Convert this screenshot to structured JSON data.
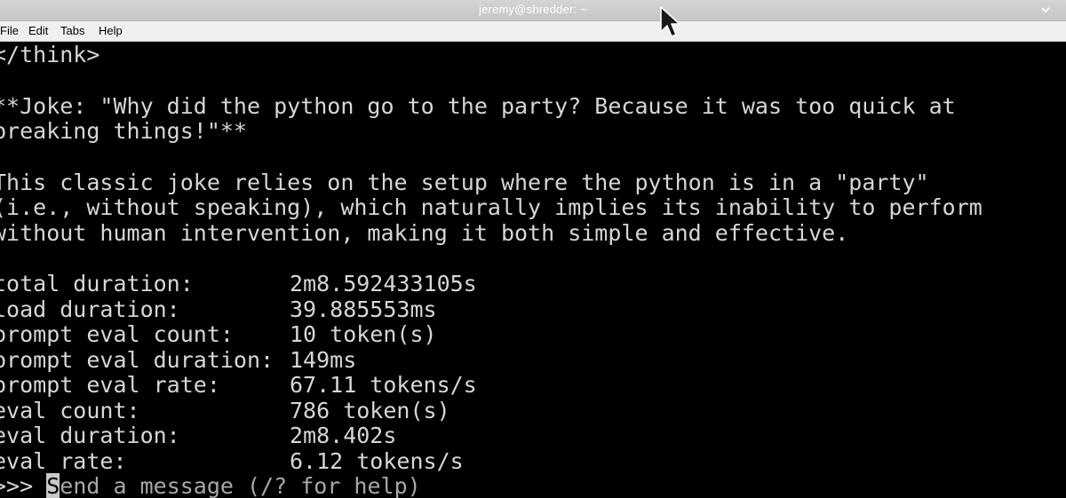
{
  "window": {
    "title": "jeremy@shredder: ~"
  },
  "menu": {
    "items": [
      "File",
      "Edit",
      "Tabs",
      "Help"
    ]
  },
  "terminal": {
    "line_think": "</think>",
    "joke_line1": "**Joke: \"Why did the python go to the party? Because it was too quick at",
    "joke_line2": "breaking things!\"**",
    "explain_line1": "This classic joke relies on the setup where the python is in a \"party\"",
    "explain_line2": "(i.e., without speaking), which naturally implies its inability to perform",
    "explain_line3": "without human intervention, making it both simple and effective.",
    "stats": [
      {
        "label": "total duration:",
        "value": "2m8.592433105s"
      },
      {
        "label": "load duration:",
        "value": "39.885553ms"
      },
      {
        "label": "prompt eval count:",
        "value": "10 token(s)"
      },
      {
        "label": "prompt eval duration:",
        "value": "149ms"
      },
      {
        "label": "prompt eval rate:",
        "value": "67.11 tokens/s"
      },
      {
        "label": "eval count:",
        "value": "786 token(s)"
      },
      {
        "label": "eval duration:",
        "value": "2m8.402s"
      },
      {
        "label": "eval rate:",
        "value": "6.12 tokens/s"
      }
    ],
    "prompt": {
      "symbol": ">>> ",
      "cursor_char": "S",
      "placeholder_rest": "end a message (/? for help)"
    }
  },
  "colors": {
    "terminal_bg": "#000000",
    "terminal_fg": "#d6d6d6",
    "titlebar_bg": "#c8c8c8",
    "menubar_bg": "#efefef"
  },
  "icons": {
    "window_menu": "chevron-down-icon",
    "mouse": "mouse-pointer-icon"
  }
}
